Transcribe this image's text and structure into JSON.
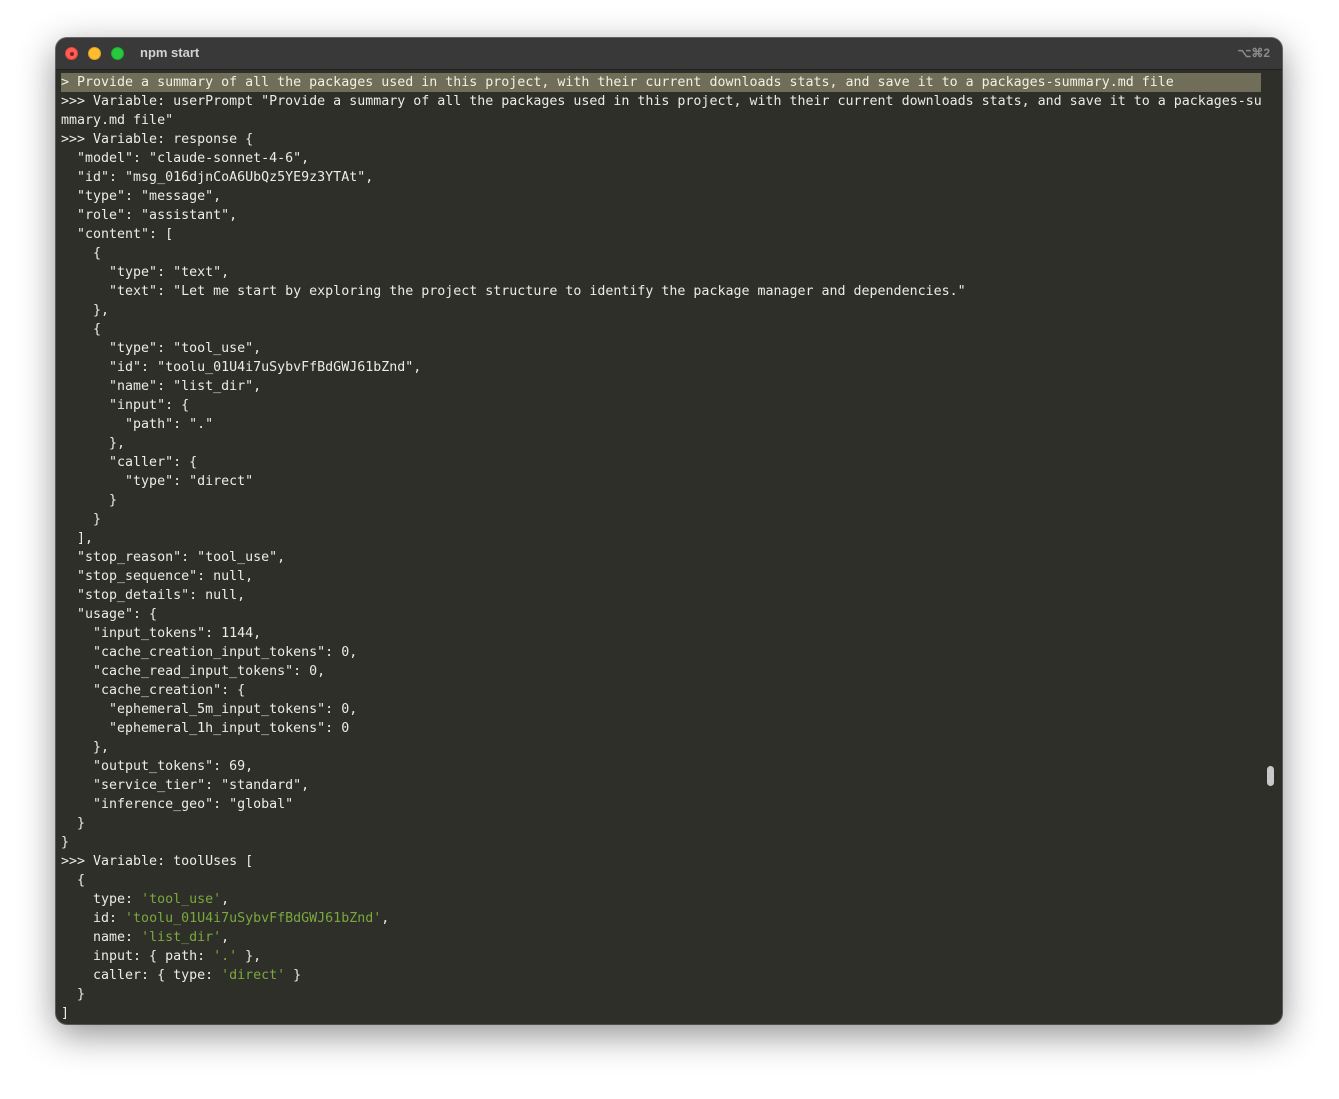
{
  "window": {
    "title": "npm start",
    "shortcut": "⌥⌘2"
  },
  "terminal": {
    "lines": [
      "> Provide a summary of all the packages used in this project, with their current downloads stats, and save it to a packages-summary.md file",
      ">>> Variable: userPrompt \"Provide a summary of all the packages used in this project, with their current downloads stats, and save it to a packages-su",
      "mmary.md file\"",
      ">>> Variable: response {",
      "  \"model\": \"claude-sonnet-4-6\",",
      "  \"id\": \"msg_016djnCoA6UbQz5YE9z3YTAt\",",
      "  \"type\": \"message\",",
      "  \"role\": \"assistant\",",
      "  \"content\": [",
      "    {",
      "      \"type\": \"text\",",
      "      \"text\": \"Let me start by exploring the project structure to identify the package manager and dependencies.\"",
      "    },",
      "    {",
      "      \"type\": \"tool_use\",",
      "      \"id\": \"toolu_01U4i7uSybvFfBdGWJ61bZnd\",",
      "      \"name\": \"list_dir\",",
      "      \"input\": {",
      "        \"path\": \".\"",
      "      },",
      "      \"caller\": {",
      "        \"type\": \"direct\"",
      "      }",
      "    }",
      "  ],",
      "  \"stop_reason\": \"tool_use\",",
      "  \"stop_sequence\": null,",
      "  \"stop_details\": null,",
      "  \"usage\": {",
      "    \"input_tokens\": 1144,",
      "    \"cache_creation_input_tokens\": 0,",
      "    \"cache_read_input_tokens\": 0,",
      "    \"cache_creation\": {",
      "      \"ephemeral_5m_input_tokens\": 0,",
      "      \"ephemeral_1h_input_tokens\": 0",
      "    },",
      "    \"output_tokens\": 69,",
      "    \"service_tier\": \"standard\",",
      "    \"inference_geo\": \"global\"",
      "  }",
      "}",
      ">>> Variable: toolUses [",
      "  {"
    ],
    "tool_uses_block": {
      "type_key": "    type: ",
      "type_val": "'tool_use'",
      "type_end": ",",
      "id_key": "    id: ",
      "id_val": "'toolu_01U4i7uSybvFfBdGWJ61bZnd'",
      "id_end": ",",
      "name_key": "    name: ",
      "name_val": "'list_dir'",
      "name_end": ",",
      "input_key": "    input: { path: ",
      "input_val": "'.'",
      "input_end": " },",
      "caller_key": "    caller: { type: ",
      "caller_val": "'direct'",
      "caller_end": " }",
      "close_obj": "  }",
      "close_arr": "]"
    }
  },
  "colors": {
    "background": "#2f2f2a",
    "highlight": "#706e58",
    "string_green": "#7aa83f",
    "text": "#ecece6"
  }
}
